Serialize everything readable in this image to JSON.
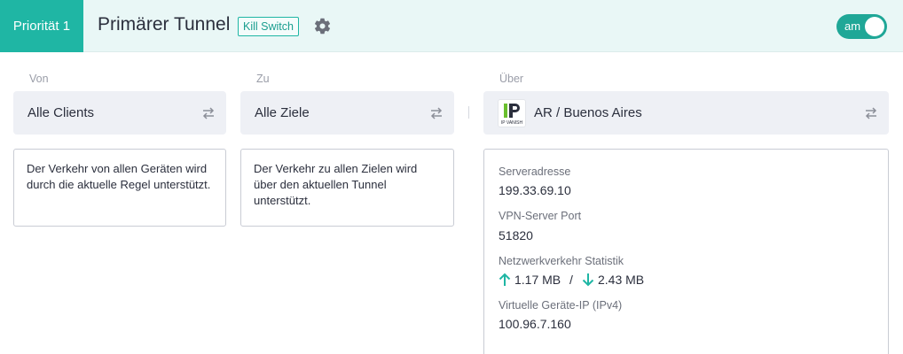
{
  "header": {
    "priority_label": "Priorität 1",
    "tunnel_title": "Primärer Tunnel",
    "kill_switch_label": "Kill Switch",
    "toggle_label": "am",
    "toggle_state": "on"
  },
  "colors": {
    "accent": "#1fb6a4",
    "header_bg": "#e9f7f6",
    "toggle_bg": "#1fa797",
    "select_bg": "#eef0f5",
    "traffic_arrow": "#1fb6a4"
  },
  "from": {
    "label": "Von",
    "value": "Alle Clients",
    "description": "Der Verkehr von allen Geräten wird durch die aktuelle Regel unterstützt."
  },
  "to": {
    "label": "Zu",
    "value": "Alle Ziele",
    "description": "Der Verkehr zu allen Zielen wird über den aktuellen Tunnel unterstützt."
  },
  "via": {
    "label": "Über",
    "value": "AR / Buenos Aires",
    "logo_text": "IP VANISH",
    "server_address_label": "Serveradresse",
    "server_address": "199.33.69.10",
    "port_label": "VPN-Server Port",
    "port": "51820",
    "traffic_label": "Netzwerkverkehr Statistik",
    "upload": "1.17 MB",
    "separator": "/",
    "download": "2.43 MB",
    "virtual_ip_label": "Virtuelle Geräte-IP (IPv4)",
    "virtual_ip": "100.96.7.160"
  },
  "icons": {
    "settings": "gear-icon",
    "swap": "swap-arrows-icon",
    "upload": "arrow-up-icon",
    "download": "arrow-down-icon"
  }
}
